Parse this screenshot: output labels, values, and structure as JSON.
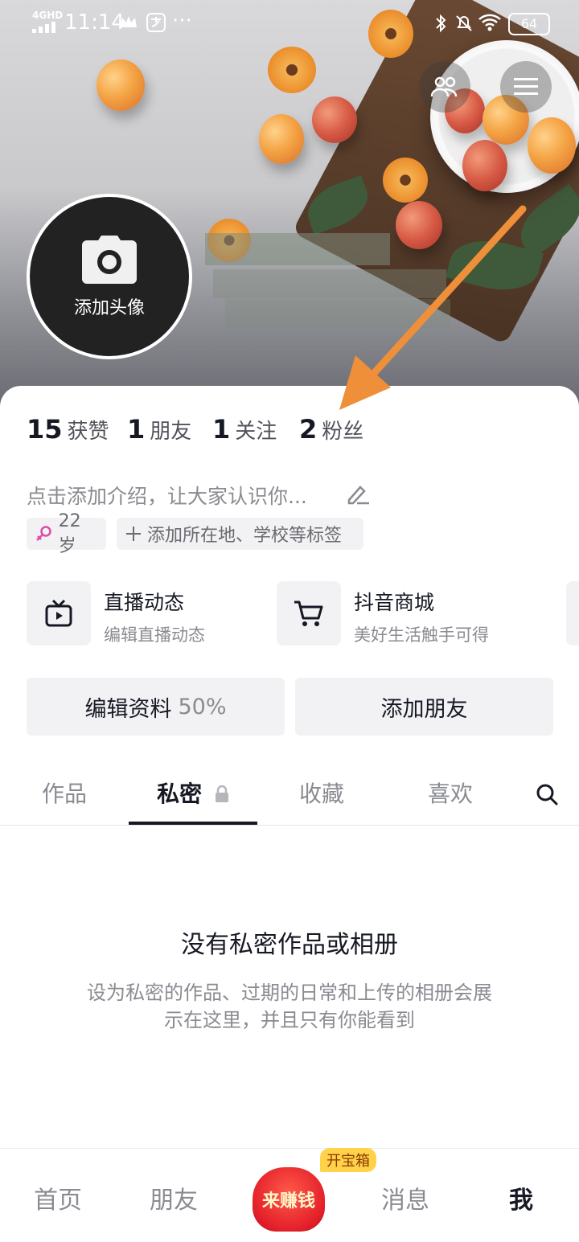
{
  "status_bar": {
    "network": "4GHD",
    "time": "11:14",
    "more": "···",
    "battery": "64"
  },
  "profile": {
    "avatar_label": "添加头像",
    "stats": [
      {
        "num": "15",
        "label": "获赞"
      },
      {
        "num": "1",
        "label": "朋友"
      },
      {
        "num": "1",
        "label": "关注"
      },
      {
        "num": "2",
        "label": "粉丝"
      }
    ],
    "intro": "点击添加介绍，让大家认识你...",
    "tags": [
      {
        "text": "22岁"
      },
      {
        "text": "添加所在地、学校等标签"
      }
    ]
  },
  "features": [
    {
      "title": "直播动态",
      "subtitle": "编辑直播动态"
    },
    {
      "title": "抖音商城",
      "subtitle": "美好生活触手可得"
    }
  ],
  "actions": {
    "edit_label": "编辑资料",
    "edit_pct": "50%",
    "add_friend": "添加朋友"
  },
  "tabs": [
    "作品",
    "私密",
    "收藏",
    "喜欢"
  ],
  "empty": {
    "title": "没有私密作品或相册",
    "desc_line1": "设为私密的作品、过期的日常和上传的相册会展",
    "desc_line2": "示在这里，并且只有你能看到"
  },
  "bottom_nav": {
    "home": "首页",
    "friends": "朋友",
    "earn": "来赚钱",
    "earn_badge": "开宝箱",
    "messages": "消息",
    "me": "我"
  },
  "colors": {
    "arrow": "#ef8f3a",
    "text_primary": "#161823",
    "text_secondary": "#8a8b91"
  }
}
